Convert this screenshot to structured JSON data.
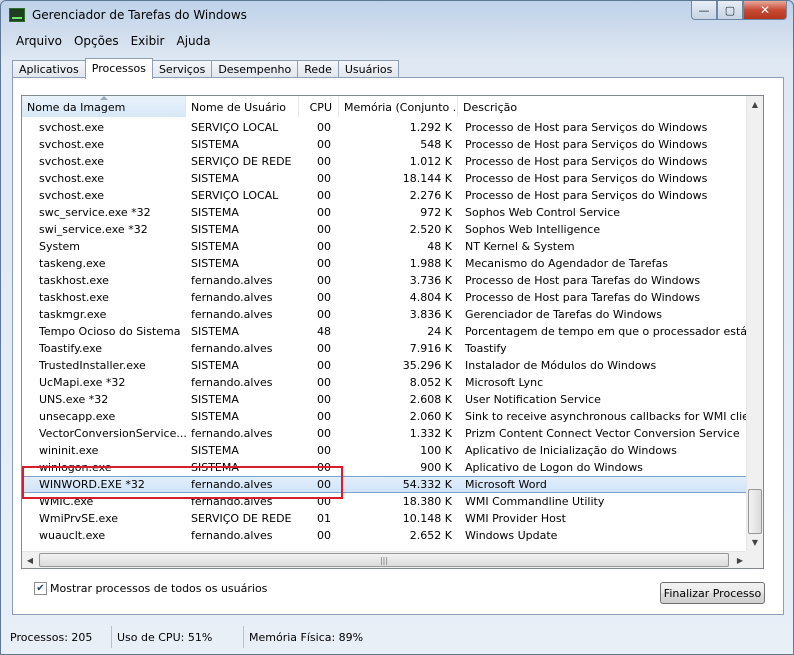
{
  "window": {
    "title": "Gerenciador de Tarefas do Windows",
    "buttons": {
      "minimize": "—",
      "maximize": "▢",
      "close": "✕"
    }
  },
  "menu": [
    {
      "label": "Arquivo"
    },
    {
      "label": "Opções"
    },
    {
      "label": "Exibir"
    },
    {
      "label": "Ajuda"
    }
  ],
  "tabs": [
    "Aplicativos",
    "Processos",
    "Serviços",
    "Desempenho",
    "Rede",
    "Usuários"
  ],
  "active_tab": "Processos",
  "columns": [
    "Nome da Imagem",
    "Nome de Usuário",
    "CPU",
    "Memória (Conjunto ...",
    "Descrição"
  ],
  "processes": [
    {
      "name": "svchost.exe",
      "user": "SERVIÇO LOCAL",
      "cpu": "00",
      "mem": "1.292 K",
      "desc": "Processo de Host para Serviços do Windows"
    },
    {
      "name": "svchost.exe",
      "user": "SISTEMA",
      "cpu": "00",
      "mem": "548 K",
      "desc": "Processo de Host para Serviços do Windows"
    },
    {
      "name": "svchost.exe",
      "user": "SERVIÇO DE REDE",
      "cpu": "00",
      "mem": "1.012 K",
      "desc": "Processo de Host para Serviços do Windows"
    },
    {
      "name": "svchost.exe",
      "user": "SISTEMA",
      "cpu": "00",
      "mem": "18.144 K",
      "desc": "Processo de Host para Serviços do Windows"
    },
    {
      "name": "svchost.exe",
      "user": "SERVIÇO LOCAL",
      "cpu": "00",
      "mem": "2.276 K",
      "desc": "Processo de Host para Serviços do Windows"
    },
    {
      "name": "swc_service.exe *32",
      "user": "SISTEMA",
      "cpu": "00",
      "mem": "972 K",
      "desc": "Sophos Web Control Service"
    },
    {
      "name": "swi_service.exe *32",
      "user": "SISTEMA",
      "cpu": "00",
      "mem": "2.520 K",
      "desc": "Sophos Web Intelligence"
    },
    {
      "name": "System",
      "user": "SISTEMA",
      "cpu": "00",
      "mem": "48 K",
      "desc": "NT Kernel & System"
    },
    {
      "name": "taskeng.exe",
      "user": "SISTEMA",
      "cpu": "00",
      "mem": "1.988 K",
      "desc": "Mecanismo do Agendador de Tarefas"
    },
    {
      "name": "taskhost.exe",
      "user": "fernando.alves",
      "cpu": "00",
      "mem": "3.736 K",
      "desc": "Processo de Host para Tarefas do Windows"
    },
    {
      "name": "taskhost.exe",
      "user": "fernando.alves",
      "cpu": "00",
      "mem": "4.804 K",
      "desc": "Processo de Host para Tarefas do Windows"
    },
    {
      "name": "taskmgr.exe",
      "user": "fernando.alves",
      "cpu": "00",
      "mem": "3.836 K",
      "desc": "Gerenciador de Tarefas do Windows"
    },
    {
      "name": "Tempo Ocioso do Sistema",
      "user": "SISTEMA",
      "cpu": "48",
      "mem": "24 K",
      "desc": "Porcentagem de tempo em que o processador está ocioso"
    },
    {
      "name": "Toastify.exe",
      "user": "fernando.alves",
      "cpu": "00",
      "mem": "7.916 K",
      "desc": "Toastify"
    },
    {
      "name": "TrustedInstaller.exe",
      "user": "SISTEMA",
      "cpu": "00",
      "mem": "35.296 K",
      "desc": "Instalador de Módulos do Windows"
    },
    {
      "name": "UcMapi.exe *32",
      "user": "fernando.alves",
      "cpu": "00",
      "mem": "8.052 K",
      "desc": "Microsoft Lync"
    },
    {
      "name": "UNS.exe *32",
      "user": "SISTEMA",
      "cpu": "00",
      "mem": "2.608 K",
      "desc": "User Notification Service"
    },
    {
      "name": "unsecapp.exe",
      "user": "SISTEMA",
      "cpu": "00",
      "mem": "2.060 K",
      "desc": "Sink to receive asynchronous callbacks for WMI client appli"
    },
    {
      "name": "VectorConversionService....",
      "user": "fernando.alves",
      "cpu": "00",
      "mem": "1.332 K",
      "desc": "Prizm Content Connect Vector Conversion Service"
    },
    {
      "name": "wininit.exe",
      "user": "SISTEMA",
      "cpu": "00",
      "mem": "100 K",
      "desc": "Aplicativo de Inicialização do Windows"
    },
    {
      "name": "winlogon.exe",
      "user": "SISTEMA",
      "cpu": "00",
      "mem": "900 K",
      "desc": "Aplicativo de Logon do Windows"
    },
    {
      "name": "WINWORD.EXE *32",
      "user": "fernando.alves",
      "cpu": "00",
      "mem": "54.332 K",
      "desc": "Microsoft Word",
      "selected": true
    },
    {
      "name": "WMIC.exe",
      "user": "fernando.alves",
      "cpu": "00",
      "mem": "18.380 K",
      "desc": "WMI Commandline Utility"
    },
    {
      "name": "WmiPrvSE.exe",
      "user": "SERVIÇO DE REDE",
      "cpu": "01",
      "mem": "10.148 K",
      "desc": "WMI Provider Host"
    },
    {
      "name": "wuauclt.exe",
      "user": "fernando.alves",
      "cpu": "00",
      "mem": "2.652 K",
      "desc": "Windows Update"
    }
  ],
  "show_all_label": "Mostrar processos de todos os usuários",
  "show_all_checked": true,
  "end_process_label": "Finalizar Processo",
  "status": {
    "processes": "Processos: 205",
    "cpu": "Uso de CPU: 51%",
    "memory": "Memória Física: 89%"
  },
  "colors": {
    "selection_border": "#7da2ce",
    "highlight_box": "#d81e2c"
  }
}
